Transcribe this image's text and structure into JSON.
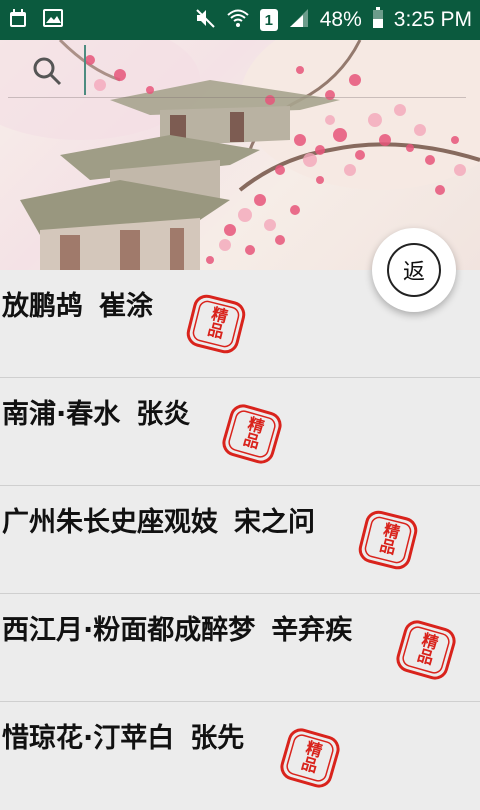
{
  "status_bar": {
    "battery": "48%",
    "time": "3:25 PM",
    "sim_badge": "1",
    "icons": [
      "calendar-icon",
      "image-icon",
      "mute-icon",
      "wifi-icon",
      "sim-icon",
      "signal-icon",
      "battery-icon"
    ]
  },
  "search": {
    "icon": "search-icon",
    "value": ""
  },
  "return_button": {
    "label": "返"
  },
  "poems": [
    {
      "title": "放鹏鸪",
      "author": "崔涂",
      "badge": "精品"
    },
    {
      "title": "南浦·春水",
      "author": "张炎",
      "badge": "精品"
    },
    {
      "title": "广州朱长史座观妓",
      "author": "宋之问",
      "badge": "精品"
    },
    {
      "title": "西江月·粉面都成醉梦",
      "author": "辛弃疾",
      "badge": "精品"
    },
    {
      "title": "惜琼花·汀苹白",
      "author": "张先",
      "badge": "精品"
    }
  ],
  "colors": {
    "status_bar": "#0b5a3e",
    "stamp_red": "#d9231c",
    "list_bg": "#ececec"
  }
}
